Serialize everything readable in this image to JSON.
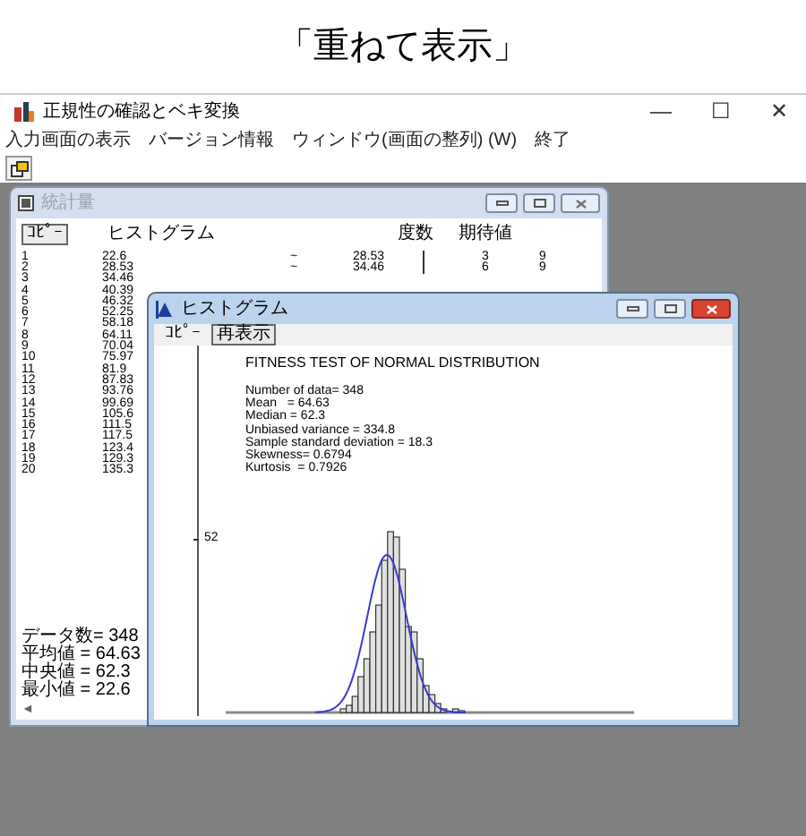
{
  "caption": "「重ねて表示」",
  "window": {
    "title": "正規性の確認とベキ変換",
    "controls": [
      "—",
      "☐",
      "✕"
    ],
    "menu": [
      "入力画面の表示",
      "バージョン情報",
      "ウィンドウ(画面の整列) (W)",
      "終了"
    ]
  },
  "statistics_window": {
    "title": "統計量",
    "active": false,
    "copy_button": "ｺﾋﾟｰ",
    "heading": "ヒストグラム",
    "columns": [
      "度数",
      "期待値"
    ],
    "rows": [
      {
        "index": "1",
        "value": "22.6"
      },
      {
        "index": "2",
        "value": "28.53"
      },
      {
        "index": "3",
        "value": "34.46"
      },
      {
        "index": "4",
        "value": "40.39"
      },
      {
        "index": "5",
        "value": "46.32"
      },
      {
        "index": "6",
        "value": "52.25"
      },
      {
        "index": "7",
        "value": "58.18"
      },
      {
        "index": "8",
        "value": "64.11"
      },
      {
        "index": "9",
        "value": "70.04"
      },
      {
        "index": "10",
        "value": "75.97"
      },
      {
        "index": "11",
        "value": "81.9"
      },
      {
        "index": "12",
        "value": "87.83"
      },
      {
        "index": "13",
        "value": "93.76"
      },
      {
        "index": "14",
        "value": "99.69"
      },
      {
        "index": "15",
        "value": "105.6"
      },
      {
        "index": "16",
        "value": "111.5"
      },
      {
        "index": "17",
        "value": "117.5"
      },
      {
        "index": "18",
        "value": "123.4"
      },
      {
        "index": "19",
        "value": "129.3"
      },
      {
        "index": "20",
        "value": "135.3"
      }
    ],
    "class_rows": [
      {
        "separator": "~",
        "upper": "28.53",
        "frequency": "3",
        "expected": "9"
      },
      {
        "separator": "~",
        "upper": "34.46",
        "frequency": "6",
        "expected": "9"
      }
    ],
    "summary": [
      "データ数= 348",
      "平均値 = 64.63",
      "中央値 = 62.3",
      "最小値 = 22.6"
    ],
    "scroll_arrow": "◄"
  },
  "histogram_window": {
    "title": "ヒストグラム",
    "active": true,
    "buttons": [
      "ｺﾋﾟｰ",
      "再表示"
    ],
    "report_title": "FITNESS TEST OF NORMAL DISTRIBUTION",
    "stats": [
      "Number of data= 348",
      "Mean   = 64.63",
      "Median = 62.3",
      "Unbiased variance = 334.8",
      "Sample standard deviation = 18.3",
      "Skewness= 0.6794",
      "Kurtosis  = 0.7926"
    ],
    "y_tick": "52"
  }
}
